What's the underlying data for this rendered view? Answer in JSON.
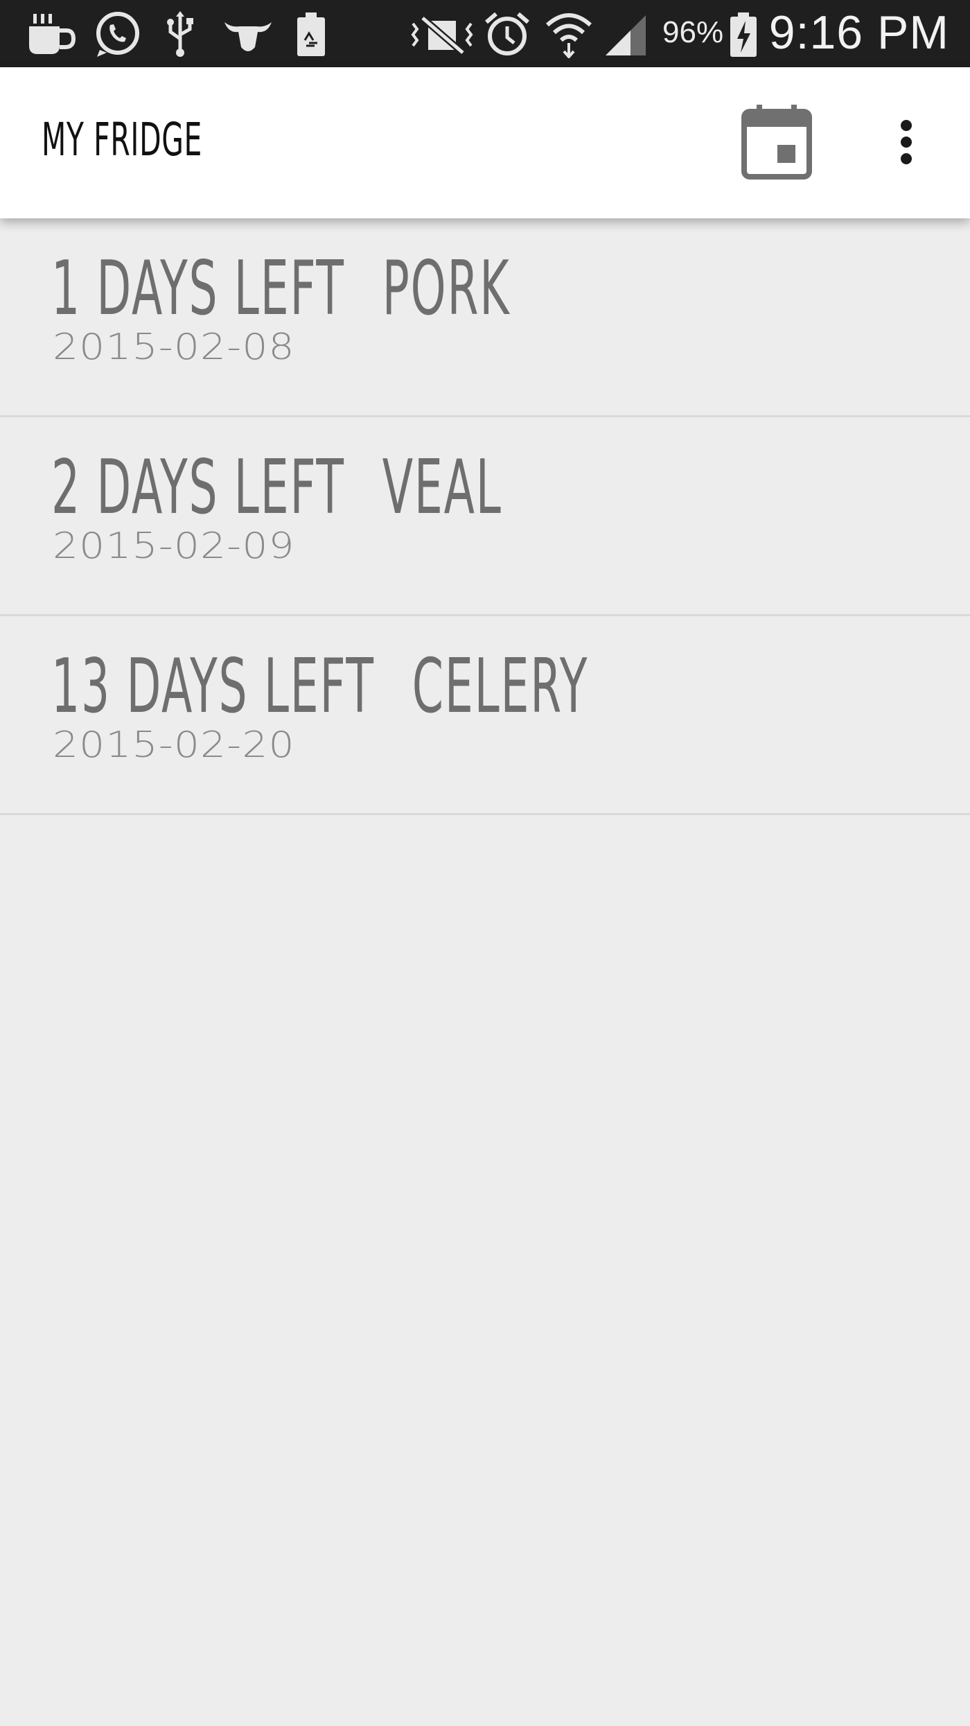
{
  "status_bar": {
    "icons": [
      "coffee-icon",
      "whatsapp-icon",
      "usb-icon",
      "bull-icon",
      "battery-recycle-icon",
      "vibrate-icon",
      "alarm-icon",
      "wifi-icon",
      "signal-icon",
      "battery-charging-icon"
    ],
    "battery_percent": "96%",
    "time": "9:16 PM"
  },
  "app_bar": {
    "title": "MY FRIDGE",
    "calendar_icon": "calendar-icon",
    "overflow_icon": "more-vert-icon"
  },
  "items": [
    {
      "days_left": "1 DAYS LEFT",
      "name": "PORK",
      "date": "2015-02-08"
    },
    {
      "days_left": "2 DAYS LEFT",
      "name": "VEAL",
      "date": "2015-02-09"
    },
    {
      "days_left": "13 DAYS LEFT",
      "name": "CELERY",
      "date": "2015-02-20"
    }
  ],
  "colors": {
    "status_bar_bg": "#1f1f1f",
    "app_bar_bg": "#ffffff",
    "list_bg": "#ededed",
    "item_text": "#6e6e6e",
    "date_text": "#8a8a8a",
    "calendar_icon": "#707070"
  }
}
